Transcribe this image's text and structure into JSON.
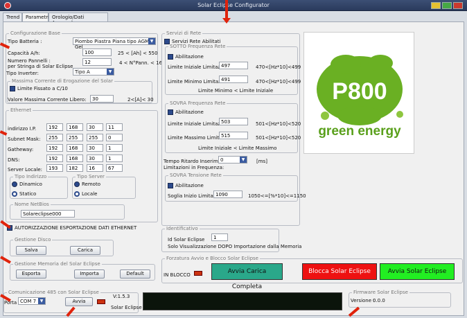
{
  "window": {
    "title": "Solar Eclipse Configurator"
  },
  "tabs": [
    {
      "label": "Trend"
    },
    {
      "label": "Parametri"
    },
    {
      "label": "Orologio/Dati Accumulo"
    }
  ],
  "config_base": {
    "legend": "Configurazione Base",
    "tipo_batteria_label": "Tipo Batteria :",
    "tipo_batteria_value": "Piombo Piastra Piana tipo AGM Gel",
    "capacita_label": "Capacità A/h:",
    "capacita_value": "100",
    "capacita_range": "25 < [Ah] < 550",
    "numero_pannelli_label": "Numero Pannelli :",
    "numero_pannelli_sub": "per Stringa di Solar Eclipse",
    "numero_pannelli_value": "12",
    "numero_pannelli_range": "4 < N°Pann. < 16",
    "tipo_inverter_label": "Tipo Inverter:",
    "tipo_inverter_value": "Tipo A"
  },
  "corrente": {
    "legend": "Massima Corrente di Erogazione del Solar",
    "limite_label": "Limite Fissato a C/10",
    "valore_label": "Valore Massima Corrente Libero:",
    "valore_value": "30",
    "valore_range": "2<[A]< 30"
  },
  "ethernet": {
    "legend": "Ethernet",
    "ip_label": "indirizzo I.P.",
    "ip": [
      "192",
      "168",
      "30",
      "11"
    ],
    "mask_label": "Subnet Mask:",
    "mask": [
      "255",
      "255",
      "255",
      "0"
    ],
    "gw_label": "Gatheway:",
    "gw": [
      "192",
      "168",
      "30",
      "1"
    ],
    "dns_label": "DNS:",
    "dns": [
      "192",
      "168",
      "30",
      "1"
    ],
    "server_label": "Server Locale:",
    "server": [
      "193",
      "182",
      "16",
      "67"
    ],
    "tipo_indirizzo_legend": "Tipo Indirizzo",
    "dinamico": "Dinamico",
    "statico": "Statico",
    "tipo_server_legend": "Tipo Server",
    "remoto": "Remoto",
    "locale": "Locale",
    "netbios_legend": "Nome NetBios",
    "netbios_value": "Solareclipse000"
  },
  "autorizzazione": "AUTORIZZAZIONE ESPORTAZIONE DATI ETHERNET",
  "disco": {
    "legend": "Gestione Disco",
    "salva": "Salva",
    "carica": "Carica"
  },
  "memoria": {
    "legend": "Gestione Memoria del  Solar Eclipse",
    "esporta": "Esporta",
    "importa": "Importa",
    "default": "Default"
  },
  "comm": {
    "legend": "Comunicazione 485 con  Solar Eclipse",
    "porta_label": "Porta",
    "porta_value": "COM 7",
    "avvia": "Avvia",
    "version": "V:1.5.3",
    "device": "Solar Eclipse"
  },
  "servizi": {
    "legend": "Servizi di Rete",
    "abilitati": "Servizi Rete Abilitati",
    "sotto": {
      "legend": "SOTTO Frequenza Rete",
      "abilitazione": "Abilitazione",
      "lim_iniz_label": "Limite Iniziale Limitazione :",
      "lim_iniz_value": "497",
      "lim_iniz_range": "470<[Hz*10]<499",
      "lim_min_label": "Limite Minimo Limitazione :",
      "lim_min_value": "491",
      "lim_min_range": "470<[Hz*10]<499",
      "note": "Limite Minimo < Limite Iniziale"
    },
    "sovra": {
      "legend": "SOVRA Frequenza Rete",
      "abilitazione": "Abilitazione",
      "lim_iniz_label": "Limite Iniziale Limitazione :",
      "lim_iniz_value": "503",
      "lim_iniz_range": "501<[Hz*10]<520",
      "lim_max_label": "Limite Massimo Limitazione :",
      "lim_max_value": "515",
      "lim_max_range": "501<[Hz*10]<520",
      "note": "Limite Iniziale < Limite Massimo"
    },
    "ritardo_label": "Tempo Ritardo Inserimento",
    "ritardo_label2": "Limitazioni in Frequenza:",
    "ritardo_value": "0",
    "ritardo_unit": "[ms]",
    "tensione": {
      "legend": "SOVRA Tensione Rete",
      "abilitazione": "Abilitazione",
      "soglia_label": "Soglia Inizio Limitazione :",
      "soglia_value": "1090",
      "soglia_range": "1050<=[%*10]<=1150"
    }
  },
  "identificativo": {
    "legend": "Identificativo",
    "id_label": "Id Solar Eclipse",
    "id_value": "1",
    "note": "Solo Visualizzazione DOPO Importazione dalla Memoria"
  },
  "forzatura": {
    "legend": "Forzatura Avvio e Blocco Solar Eclipse",
    "in_blocco": "IN BLOCCO",
    "avvia_carica": "Avvia Carica Completa",
    "blocca": "Blocca Solar Eclipse",
    "avvia": "Avvia Solar Eclipse"
  },
  "firmware": {
    "legend": "Firmware  Solar Eclipse",
    "versione_label": "Versione :",
    "versione_value": "0.0.0"
  },
  "logo": {
    "text": "P800",
    "tagline": "green energy"
  },
  "colors": {
    "accent": "#2c4a8c",
    "red": "#e0230c",
    "green_btn": "#22ee22",
    "red_btn": "#ee1111",
    "teal_btn": "#2aa88a",
    "logo_green": "#6ab023"
  }
}
